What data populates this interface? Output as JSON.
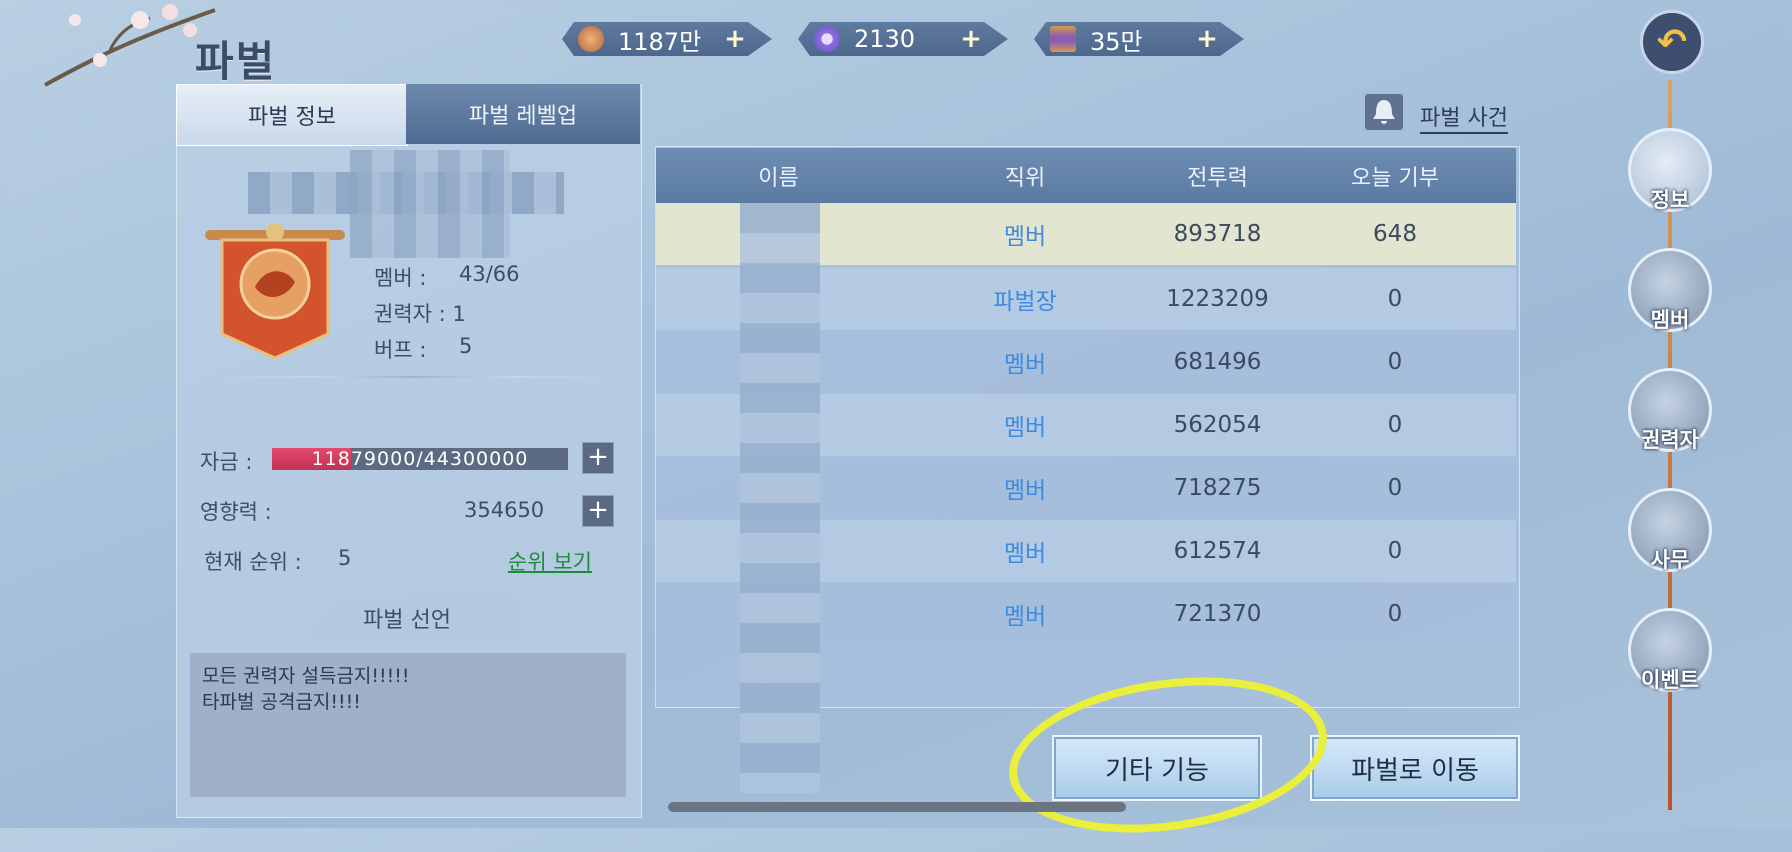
{
  "header": {
    "title": "파벌",
    "currencies": [
      {
        "icon": "copper-coin-icon",
        "value": "1187만",
        "plus": "+"
      },
      {
        "icon": "purple-gem-icon",
        "value": "2130",
        "plus": "+"
      },
      {
        "icon": "scroll-icon",
        "value": "35만",
        "plus": "+"
      }
    ],
    "back_icon": "back-arrow-icon"
  },
  "tabs": [
    {
      "label": "파벌 정보",
      "active": true
    },
    {
      "label": "파벌 레벨업",
      "active": false
    }
  ],
  "guild": {
    "emblem_icon": "dragon-banner-icon",
    "member_label": "멤버 :",
    "member_value": "43/66",
    "authority_label": "권력자 : 1",
    "buff_label": "버프 :",
    "buff_value": "5",
    "funds_label": "자금 :",
    "funds_text": "11879000/44300000",
    "funds_fraction": 0.268,
    "influence_label": "영향력 :",
    "influence_value": "354650",
    "rank_label": "현재 순위 :",
    "rank_value": "5",
    "rank_link": "순위 보기",
    "declaration_title": "파벌 선언",
    "declaration_text": "모든 권력자 설득금지!!!!!\n타파벌 공격금지!!!!"
  },
  "events": {
    "label": "파벌 사건",
    "icon": "bell-icon"
  },
  "table": {
    "headers": [
      "이름",
      "직위",
      "전투력",
      "오늘 기부"
    ],
    "rows": [
      {
        "rank": "멤버",
        "power": "893718",
        "donation": "648"
      },
      {
        "rank": "파벌장",
        "power": "1223209",
        "donation": "0"
      },
      {
        "rank": "멤버",
        "power": "681496",
        "donation": "0"
      },
      {
        "rank": "멤버",
        "power": "562054",
        "donation": "0"
      },
      {
        "rank": "멤버",
        "power": "718275",
        "donation": "0"
      },
      {
        "rank": "멤버",
        "power": "612574",
        "donation": "0"
      },
      {
        "rank": "멤버",
        "power": "721370",
        "donation": "0"
      }
    ]
  },
  "buttons": {
    "other": "기타 기능",
    "goto": "파벌로 이동"
  },
  "nav": [
    {
      "label": "정보",
      "icon": "info-icon",
      "active": true
    },
    {
      "label": "멤버",
      "icon": "members-icon",
      "active": false
    },
    {
      "label": "권력자",
      "icon": "authority-icon",
      "active": false
    },
    {
      "label": "사무",
      "icon": "task-icon",
      "active": false
    },
    {
      "label": "이벤트",
      "icon": "event-icon",
      "active": false
    }
  ]
}
